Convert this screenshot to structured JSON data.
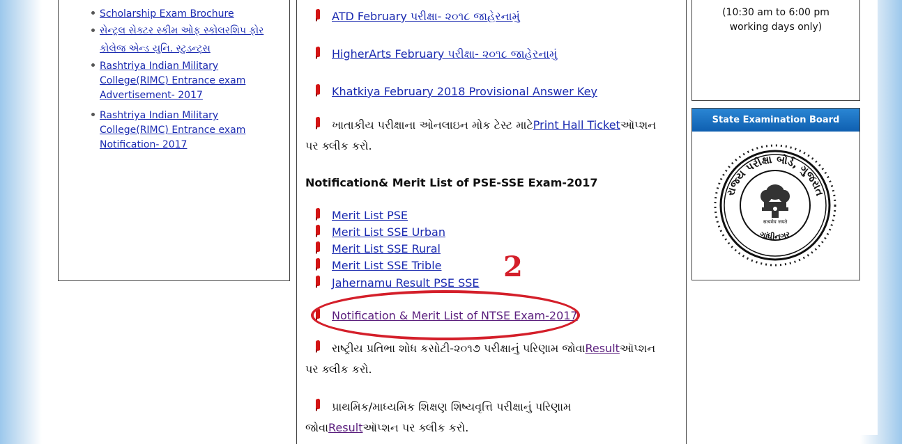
{
  "left": {
    "items": [
      {
        "label": "Scholarship Exam Brochure"
      },
      {
        "label": "સેન્ટ્રલ સેક્ટર સ્કીમ ઓફ સ્કોલરશિપ ફોર કોલેજ એન્ડ યુનિ. સ્ટુડન્ટ્સ"
      },
      {
        "label": "Rashtriya Indian Military College(RIMC) Entrance exam Advertisement- 2017"
      },
      {
        "label": "Rashtriya Indian Military College(RIMC) Entrance exam Notification- 2017"
      }
    ]
  },
  "center": {
    "links_top": [
      {
        "label": "ATD February પરીક્ષા- ૨૦૧૮ જાહેરનામું"
      },
      {
        "label": "HigherArts February પરીક્ષા- ૨૦૧૮ જાહેરનામું"
      },
      {
        "label": "Khatkiya February 2018 Provisional Answer Key"
      }
    ],
    "mock_test": {
      "prefix": "ખાતાકીય પરીક્ષાના ઓનલાઇન મોક ટેસ્ટ માટે",
      "link": "Print Hall Ticket",
      "suffix": "ઑપ્શન",
      "line2": "પર ક્લીક કરો."
    },
    "heading": "Notification& Merit List of PSE-SSE Exam-2017",
    "merit_links": [
      {
        "label": "Merit List PSE"
      },
      {
        "label": "Merit List SSE Urban"
      },
      {
        "label": "Merit List SSE Rural"
      },
      {
        "label": "Merit List SSE Trible"
      },
      {
        "label": "Jahernamu Result PSE SSE"
      }
    ],
    "ntse_link": "Notification & Merit List of NTSE Exam-2017",
    "ntse_result": {
      "prefix": "રાષ્ટ્રીય પ્રતિભા શોધ કસોટી-૨૦૧૭ પરીક્ષાનું પરિણામ જોવા",
      "link": "Result",
      "suffix": "ઑપ્શન",
      "line2": "પર ક્લીક કરો."
    },
    "scholarship_result": {
      "line1": "પ્રાથમિક/માધ્યમિક શિક્ષણ શિષ્યવૃત્તિ પરીક્ષાનું પરિણામ",
      "prefix": "જોવા",
      "link": "Result",
      "suffix": "ઑપ્શન પર ક્લીક કરો."
    }
  },
  "annotation": {
    "number": "2",
    "color": "#d41f2a"
  },
  "right": {
    "hours_line1": "(10:30 am to 6:00 pm",
    "hours_line2": "working days only)",
    "board_title": "State Examination Board",
    "seal_icon": "state-examination-board-seal-icon",
    "seal_text_top": "રાજ્ય પરીક્ષા બોર્ડ, ગુજરાત",
    "seal_text_bottom": "ગાંધીનગર",
    "seal_motto": "सत्यमेव जयते"
  },
  "colors": {
    "link": "#1a2ab0",
    "visited": "#5a1e7d",
    "flag": "#d31414",
    "board_header": "#1767b8"
  }
}
